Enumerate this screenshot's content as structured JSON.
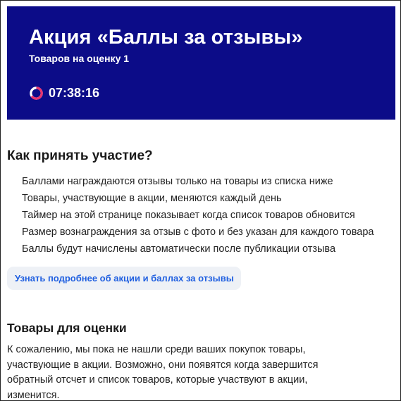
{
  "hero": {
    "title": "Акция «Баллы за отзывы»",
    "subtitle": "Товаров на оценку 1",
    "timer": "07:38:16",
    "background_color": "#0c0c88",
    "timer_ring_color": "#e8336e",
    "timer_icon": "timer-ring-icon"
  },
  "how": {
    "title": "Как принять участие?",
    "rules": [
      "Баллами награждаются отзывы только на товары из списка ниже",
      "Товары, участвующие в акции, меняются каждый день",
      "Таймер на этой странице показывает когда список товаров обновится",
      "Размер вознаграждения за отзыв с фото и без указан для каждого товара",
      "Баллы будут начислены автоматически после публикации отзыва"
    ],
    "more_button": "Узнать подробнее об акции и баллах за отзывы",
    "link_color": "#1f5fe0"
  },
  "goods": {
    "title": "Товары для оценки",
    "text": "К сожалению, мы пока не нашли среди ваших покупок товары, участвующие в акции. Возможно, они появятся когда завершится обратный отсчет и список товаров, которые участвуют в акции, изменится."
  }
}
